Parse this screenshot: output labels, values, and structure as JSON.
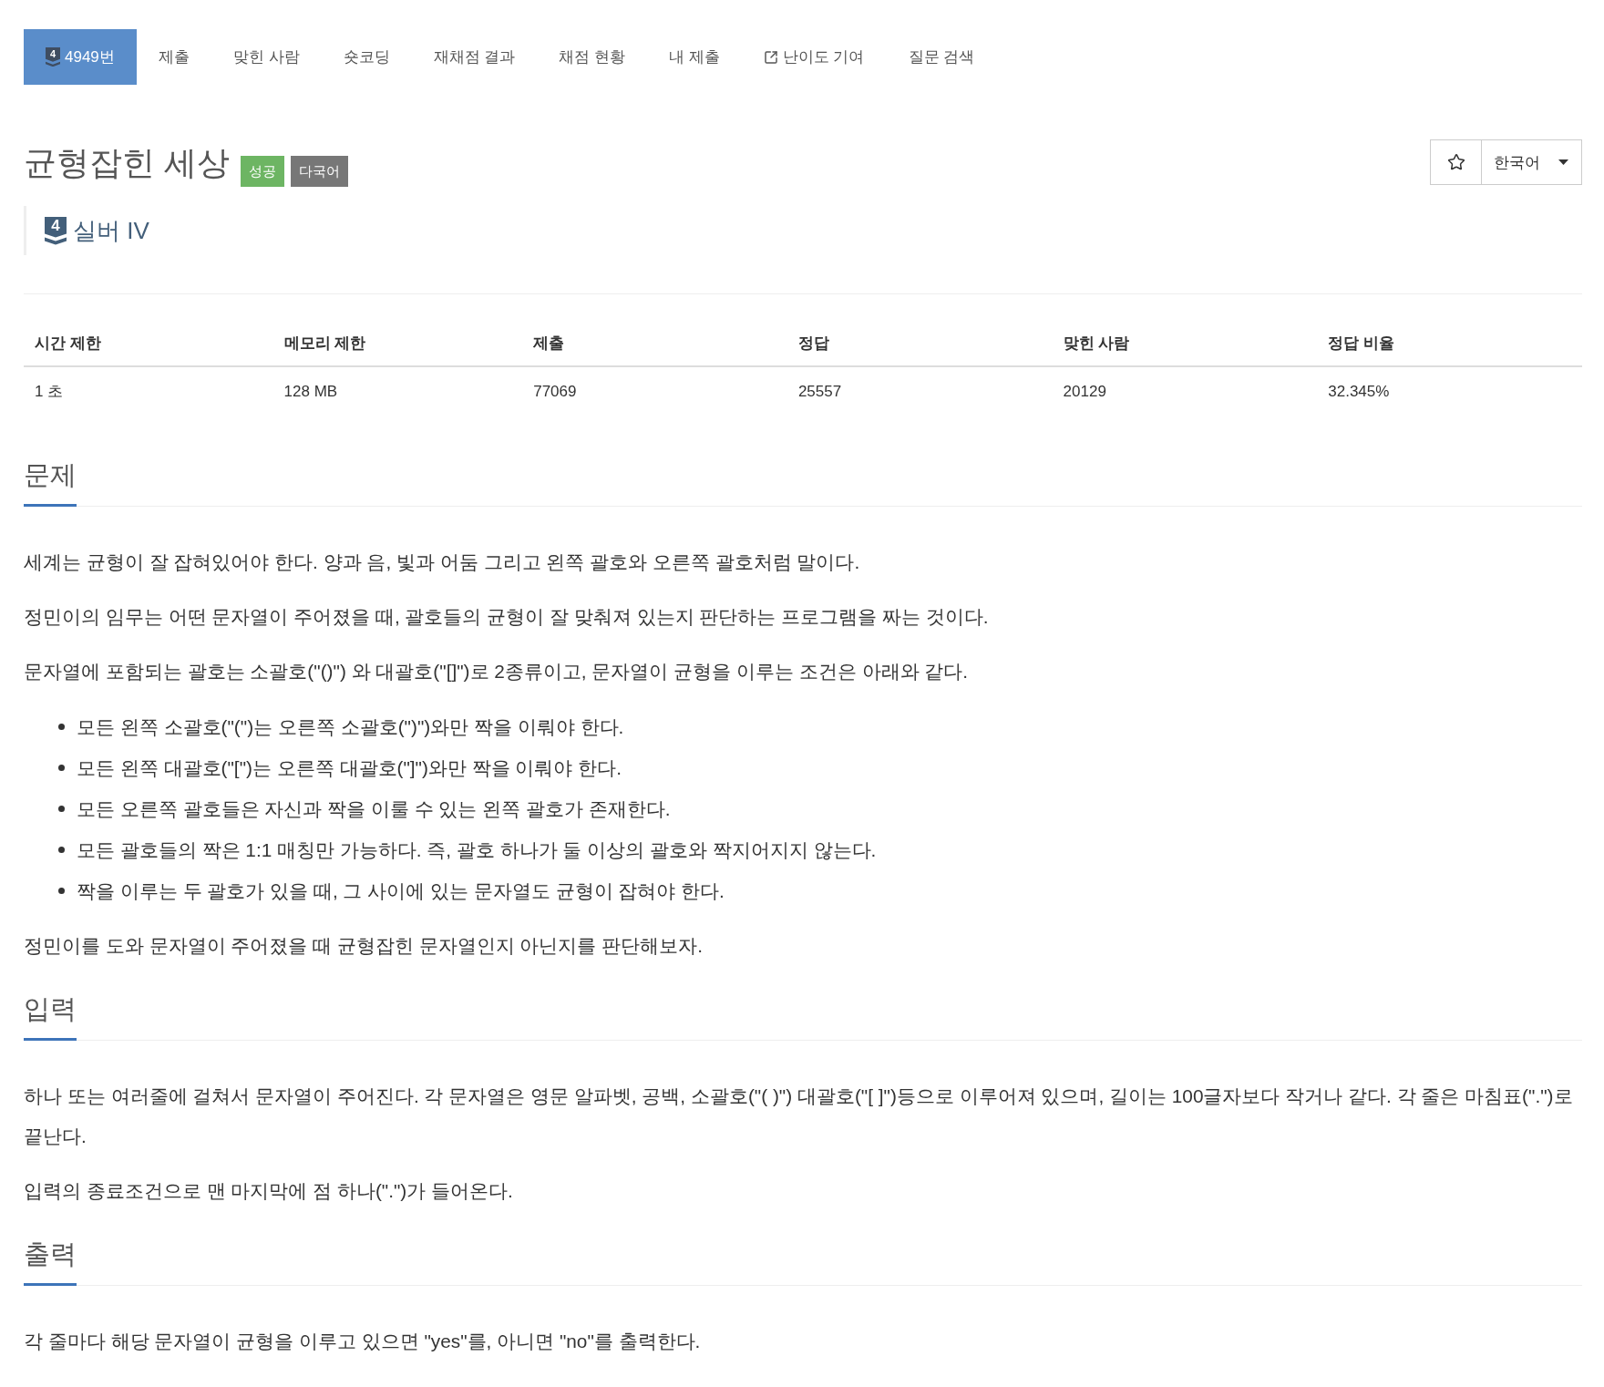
{
  "tabs": [
    {
      "kind": "problem",
      "tier_badge": "4",
      "label": "4949번",
      "selected": true
    },
    {
      "kind": "plain",
      "label": "제출",
      "selected": false
    },
    {
      "kind": "plain",
      "label": "맞힌 사람",
      "selected": false
    },
    {
      "kind": "plain",
      "label": "숏코딩",
      "selected": false
    },
    {
      "kind": "plain",
      "label": "재채점 결과",
      "selected": false
    },
    {
      "kind": "plain",
      "label": "채점 현황",
      "selected": false
    },
    {
      "kind": "plain",
      "label": "내 제출",
      "selected": false
    },
    {
      "kind": "external",
      "label": "난이도 기여",
      "selected": false
    },
    {
      "kind": "plain",
      "label": "질문 검색",
      "selected": false
    }
  ],
  "title": "균형잡힌 세상",
  "labels": [
    {
      "text": "성공",
      "color": "#6db563"
    },
    {
      "text": "다국어",
      "color": "#777777"
    }
  ],
  "favorite": {
    "starred": false
  },
  "language_menu": {
    "label": "한국어"
  },
  "tier": {
    "badge": "4",
    "label": "실버 IV"
  },
  "stats_table": {
    "columns": [
      "시간 제한",
      "메모리 제한",
      "제출",
      "정답",
      "맞힌 사람",
      "정답 비율"
    ],
    "rows": [
      [
        "1 초",
        "128 MB",
        "77069",
        "25557",
        "20129",
        "32.345%"
      ]
    ]
  },
  "sections": [
    {
      "heading": "문제",
      "blocks": [
        {
          "kind": "paragraph",
          "text": "세계는 균형이 잘 잡혀있어야 한다. 양과 음, 빛과 어둠 그리고 왼쪽 괄호와 오른쪽 괄호처럼 말이다."
        },
        {
          "kind": "paragraph",
          "text": "정민이의 임무는 어떤 문자열이 주어졌을 때, 괄호들의 균형이 잘 맞춰져 있는지 판단하는 프로그램을 짜는 것이다."
        },
        {
          "kind": "paragraph",
          "text": "문자열에 포함되는 괄호는 소괄호(\"()\") 와 대괄호(\"[]\")로 2종류이고, 문자열이 균형을 이루는 조건은 아래와 같다."
        },
        {
          "kind": "list",
          "items": [
            "모든 왼쪽 소괄호(\"(\")는 오른쪽 소괄호(\")\")와만 짝을 이뤄야 한다.",
            "모든 왼쪽 대괄호(\"[\")는 오른쪽 대괄호(\"]\")와만 짝을 이뤄야 한다.",
            "모든 오른쪽 괄호들은 자신과 짝을 이룰 수 있는 왼쪽 괄호가 존재한다.",
            "모든 괄호들의 짝은 1:1 매칭만 가능하다. 즉, 괄호 하나가 둘 이상의 괄호와 짝지어지지 않는다.",
            "짝을 이루는 두 괄호가 있을 때, 그 사이에 있는 문자열도 균형이 잡혀야 한다."
          ]
        },
        {
          "kind": "paragraph",
          "text": "정민이를 도와 문자열이 주어졌을 때 균형잡힌 문자열인지 아닌지를 판단해보자."
        }
      ]
    },
    {
      "heading": "입력",
      "blocks": [
        {
          "kind": "paragraph",
          "text": "하나 또는 여러줄에 걸쳐서 문자열이 주어진다. 각 문자열은 영문 알파벳, 공백, 소괄호(\"( )\") 대괄호(\"[ ]\")등으로 이루어져 있으며, 길이는 100글자보다 작거나 같다. 각 줄은 마침표(\".\")로 끝난다."
        },
        {
          "kind": "paragraph",
          "text": "입력의 종료조건으로 맨 마지막에 점 하나(\".\")가 들어온다."
        }
      ]
    },
    {
      "heading": "출력",
      "blocks": [
        {
          "kind": "paragraph",
          "text": "각 줄마다 해당 문자열이 균형을 이루고 있으면 \"yes\"를, 아니면 \"no\"를 출력한다."
        }
      ]
    }
  ]
}
